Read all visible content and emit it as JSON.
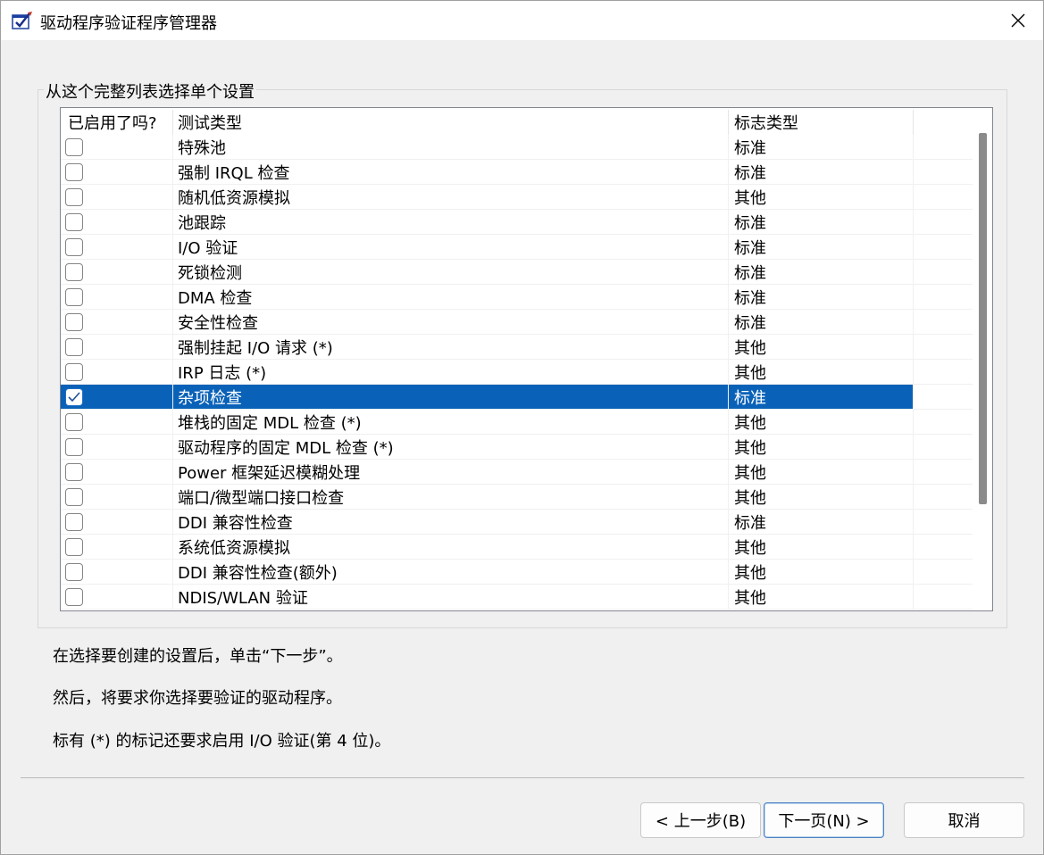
{
  "window": {
    "title": "驱动程序验证程序管理器"
  },
  "group": {
    "legend": "从这个完整列表选择单个设置"
  },
  "list": {
    "headers": [
      "已启用了吗?",
      "测试类型",
      "标志类型"
    ],
    "rows": [
      {
        "checked": false,
        "test": "特殊池",
        "flag": "标准"
      },
      {
        "checked": false,
        "test": "强制 IRQL 检查",
        "flag": "标准"
      },
      {
        "checked": false,
        "test": "随机低资源模拟",
        "flag": "其他"
      },
      {
        "checked": false,
        "test": "池跟踪",
        "flag": "标准"
      },
      {
        "checked": false,
        "test": "I/O 验证",
        "flag": "标准"
      },
      {
        "checked": false,
        "test": "死锁检测",
        "flag": "标准"
      },
      {
        "checked": false,
        "test": "DMA 检查",
        "flag": "标准"
      },
      {
        "checked": false,
        "test": "安全性检查",
        "flag": "标准"
      },
      {
        "checked": false,
        "test": "强制挂起 I/O 请求 (*)",
        "flag": "其他"
      },
      {
        "checked": false,
        "test": "IRP 日志 (*)",
        "flag": "其他"
      },
      {
        "checked": true,
        "test": "杂项检查",
        "flag": "标准",
        "selected": true
      },
      {
        "checked": false,
        "test": "堆栈的固定 MDL 检查 (*)",
        "flag": "其他"
      },
      {
        "checked": false,
        "test": "驱动程序的固定 MDL 检查 (*)",
        "flag": "其他"
      },
      {
        "checked": false,
        "test": "Power 框架延迟模糊处理",
        "flag": "其他"
      },
      {
        "checked": false,
        "test": "端口/微型端口接口检查",
        "flag": "其他"
      },
      {
        "checked": false,
        "test": "DDI 兼容性检查",
        "flag": "标准"
      },
      {
        "checked": false,
        "test": "系统低资源模拟",
        "flag": "其他"
      },
      {
        "checked": false,
        "test": "DDI 兼容性检查(额外)",
        "flag": "其他"
      },
      {
        "checked": false,
        "test": "NDIS/WLAN 验证",
        "flag": "其他"
      }
    ]
  },
  "info": {
    "line1": "在选择要创建的设置后，单击“下一步”。",
    "line2": "然后，将要求你选择要验证的驱动程序。",
    "line3": "标有 (*) 的标记还要求启用 I/O 验证(第 4 位)。"
  },
  "buttons": {
    "back": "< 上一步(B)",
    "next": "下一页(N) >",
    "cancel": "取消"
  },
  "colors": {
    "selection": "#0a62b8",
    "window_bg": "#f0f0f0"
  }
}
